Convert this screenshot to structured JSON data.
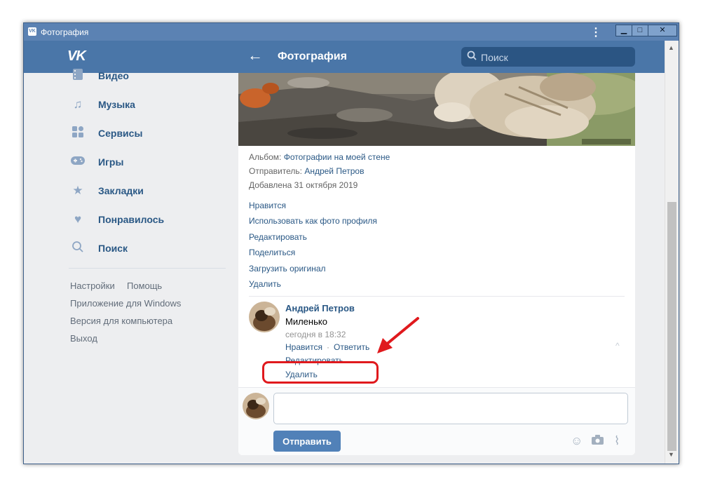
{
  "window": {
    "title": "Фотография",
    "menu_glyph": "⋮",
    "minimize": "▁",
    "maximize": "□",
    "close": "✕"
  },
  "header": {
    "logo": "VK",
    "back": "←",
    "title": "Фотография",
    "search_placeholder": "Поиск"
  },
  "sidebar": {
    "items": [
      {
        "label": "Видео",
        "icon": "video-icon"
      },
      {
        "label": "Музыка",
        "icon": "music-icon"
      },
      {
        "label": "Сервисы",
        "icon": "services-icon"
      },
      {
        "label": "Игры",
        "icon": "games-icon"
      },
      {
        "label": "Закладки",
        "icon": "bookmark-star-icon"
      },
      {
        "label": "Понравилось",
        "icon": "heart-icon"
      },
      {
        "label": "Поиск",
        "icon": "search-icon"
      }
    ],
    "footer": {
      "settings": "Настройки",
      "help": "Помощь",
      "windows_app": "Приложение для Windows",
      "desktop_version": "Версия для компьютера",
      "logout": "Выход"
    }
  },
  "photo": {
    "album_label": "Альбом:",
    "album_value": "Фотографии на моей стене",
    "sender_label": "Отправитель:",
    "sender_value": "Андрей Петров",
    "added": "Добавлена 31 октября 2019",
    "actions": [
      "Нравится",
      "Использовать как фото профиля",
      "Редактировать",
      "Поделиться",
      "Загрузить оригинал",
      "Удалить"
    ]
  },
  "comment": {
    "author": "Андрей Петров",
    "text": "Миленько",
    "time": "сегодня в 18:32",
    "like": "Нравится",
    "reply": "Ответить",
    "dot": "·",
    "edit": "Редактировать",
    "delete": "Удалить",
    "collapse": "^"
  },
  "composer": {
    "value": "",
    "send": "Отправить"
  },
  "colors": {
    "accent": "#4a76a8",
    "link": "#2a5885",
    "highlight": "#e0191d"
  }
}
